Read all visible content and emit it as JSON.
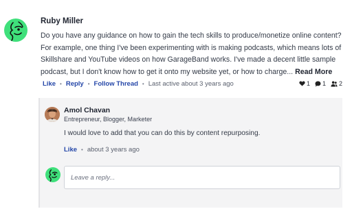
{
  "comment": {
    "author": "Ruby Miller",
    "body": "Do you have any guidance on how to gain the tech skills to produce/monetize online content? For example, one thing I've been experimenting with is making podcasts, which means lots of Skillshare and YouTube videos on how GarageBand works. I've made a decent little sample podcast, but I don't know how to get it onto my website yet, or how to charge...",
    "read_more_label": "Read More",
    "actions": {
      "like": "Like",
      "reply": "Reply",
      "follow": "Follow Thread",
      "last_active": "Last active about 3 years ago"
    },
    "stats": {
      "likes": "1",
      "comments": "1",
      "followers": "2"
    }
  },
  "reply": {
    "author": "Amol Chavan",
    "title": "Entrepreneur, Blogger, Marketer",
    "body": "I would love to add that you can do this by content repurposing.",
    "actions": {
      "like": "Like",
      "time": "about 3 years ago"
    }
  },
  "reply_input": {
    "placeholder": "Leave a reply..."
  },
  "icons": {
    "avatar": "face-line-art-icon",
    "like": "heart-icon",
    "comments": "speech-bubble-icon",
    "followers": "people-icon"
  },
  "colors": {
    "avatar_green": "#3fe07b",
    "link_blue": "#2446a8",
    "panel_gray": "#f4f4f5"
  }
}
